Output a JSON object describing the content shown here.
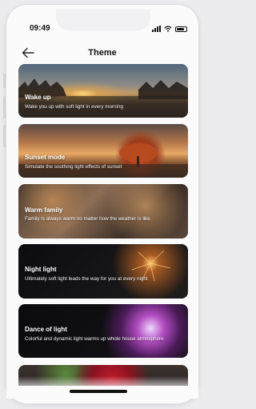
{
  "status": {
    "time": "09:49"
  },
  "header": {
    "title": "Theme",
    "back_icon": "arrow-left-icon"
  },
  "themes": [
    {
      "title": "Wake up",
      "desc": "Wake you up with soft light in every morning"
    },
    {
      "title": "Sunset mode",
      "desc": "Simulate the soothing light effects of sunset"
    },
    {
      "title": "Warm family",
      "desc": "Family is always warm no matter how the weather is like"
    },
    {
      "title": "Night light",
      "desc": "Ultimately soft light leads the way for you at every night"
    },
    {
      "title": "Dance of light",
      "desc": "Colorful and dynamic light warms up whole house atmosphere"
    }
  ]
}
